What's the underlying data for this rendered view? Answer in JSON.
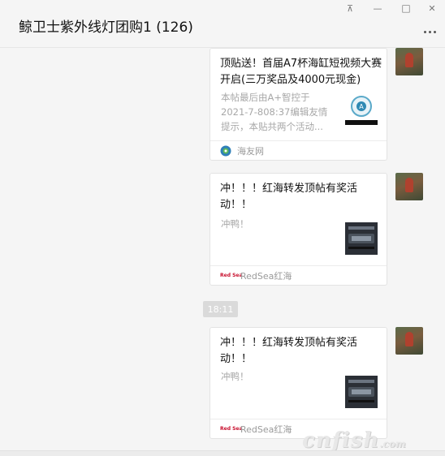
{
  "window": {
    "title": "鲸卫士紫外线灯团购1 (126)",
    "controls": {
      "pin": "⊼",
      "minimize": "—",
      "maximize": "□",
      "close": "✕"
    }
  },
  "messages": [
    {
      "type": "link-card",
      "title": "顶贴送！首届A7杯海缸短视频大赛开启(三万奖品及4000元现金)",
      "desc": "本帖最后由A+智控于2021-7-808:37编辑友情提示，本贴共两个活动...",
      "source": "海友网",
      "source_icon": "haiyou-logo-icon",
      "thumb_icon": "contest-poster-icon"
    },
    {
      "type": "link-card",
      "title": "冲！！！红海转发顶帖有奖活动！！",
      "desc": "冲鸭！",
      "source": "RedSea红海",
      "source_logo_text": "Red Sea",
      "thumb_icon": "aquarium-product-icon"
    },
    {
      "type": "time",
      "time": "18:11"
    },
    {
      "type": "link-card",
      "title": "冲！！！红海转发顶帖有奖活动！！",
      "desc": "冲鸭！",
      "source": "RedSea红海",
      "source_logo_text": "Red Sea",
      "thumb_icon": "aquarium-product-icon"
    }
  ],
  "watermark": {
    "main": "cnfish",
    "suffix": ".com"
  },
  "colors": {
    "background": "#f5f5f5",
    "card": "#ffffff",
    "muted_text": "#a8a8a8",
    "redsea_red": "#c8102e"
  }
}
